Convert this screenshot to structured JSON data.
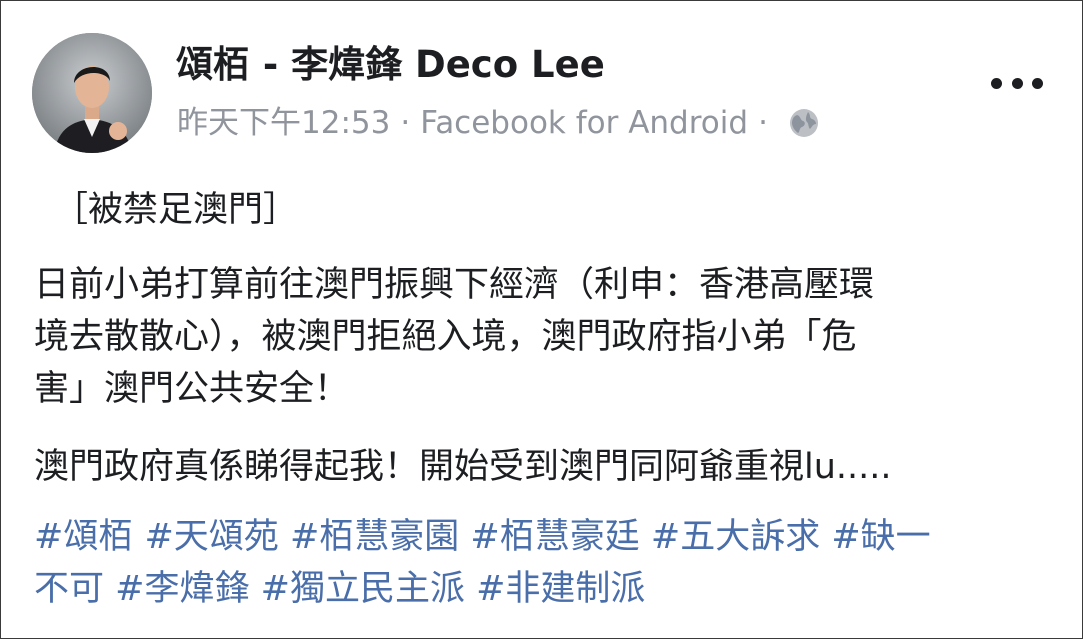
{
  "post": {
    "author": "頌栢 - 李煒鋒 Deco Lee",
    "time": "昨天下午12:53",
    "separator": "·",
    "source": "Facebook for Android",
    "privacy_icon": "globe-icon",
    "more_icon": "more-options-icon"
  },
  "content": {
    "line1": "［被禁足澳門］",
    "para2": [
      "日前小弟打算前往澳門振興下經濟（利申：香港高壓環",
      "境去散散心），被澳門拒絕入境，澳門政府指小弟「危",
      "害」澳門公共安全！"
    ],
    "para3": "澳門政府真係睇得起我！開始受到澳門同阿爺重視lu....."
  },
  "hashtags": {
    "row1": [
      "#頌栢",
      "#天頌苑",
      "#栢慧豪園",
      "#栢慧豪廷",
      "#五大訴求",
      "#缺一"
    ],
    "row2": [
      "不可",
      "#李煒鋒",
      "#獨立民主派",
      "#非建制派"
    ]
  },
  "colors": {
    "text": "#1c1e21",
    "meta": "#90949c",
    "hashtag": "#4a6ea9"
  }
}
